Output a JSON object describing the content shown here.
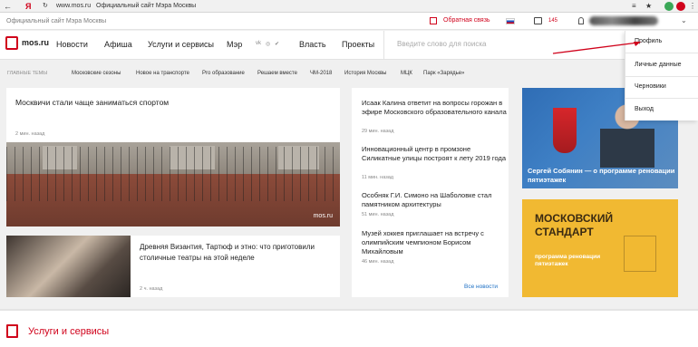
{
  "browser": {
    "url": "www.mos.ru",
    "page_title": "Официальный сайт Мэра Москвы"
  },
  "topline": {
    "official": "Официальный сайт Мэра Москвы",
    "feedback": "Обратная связь",
    "messages_count": "145"
  },
  "nav": {
    "logo": "mos.ru",
    "items": [
      "Новости",
      "Афиша",
      "Услуги и сервисы",
      "Мэр",
      "Власть",
      "Проекты"
    ],
    "search_placeholder": "Введите слово для поиска"
  },
  "themes": {
    "label": "ГЛАВНЫЕ ТЕМЫ",
    "items": [
      "Московские сезоны",
      "Новое на транспорте",
      "Pro образование",
      "Решаем вместе",
      "ЧМ-2018",
      "История Москвы",
      "МЦК",
      "Парк «Зарядье»"
    ]
  },
  "main": {
    "headline": "Москвичи стали чаще заниматься спортом",
    "headline_time": "2 мин. назад",
    "watermark": "mos.ru",
    "theatre_title": "Древняя Византия, Тартюф и этно: что приготовили столичные театры на этой неделе",
    "theatre_time": "2 ч. назад"
  },
  "news": [
    {
      "title": "Исаак Калина ответит на вопросы горожан в эфире Московского образовательного канала",
      "time": "29 мин. назад"
    },
    {
      "title": "Инновационный центр в промзоне Силикатные улицы построят к лету 2019 года",
      "time": "11 мин. назад"
    },
    {
      "title": "Особняк Г.И. Симоно на Шаболовке стал памятником архитектуры",
      "time": "51 мин. назад"
    },
    {
      "title": "Музей хоккея приглашает на встречу с олимпийским чемпионом Борисом Михайловым",
      "time": "46 мин. назад"
    }
  ],
  "all_news": "Все новости",
  "promo1": "Сергей Собянин — о программе реновации пятиэтажек",
  "promo2": {
    "title": "МОСКОВСКИЙ СТАНДАРТ",
    "subtitle": "программа реновации пятиэтажек"
  },
  "services_title": "Услуги и сервисы",
  "dropdown": [
    "Профиль",
    "Личные данные",
    "Черновики",
    "Выход"
  ],
  "colors": {
    "brand_red": "#d0021b",
    "link_blue": "#1c6fc4",
    "promo_yellow": "#f1b932"
  }
}
